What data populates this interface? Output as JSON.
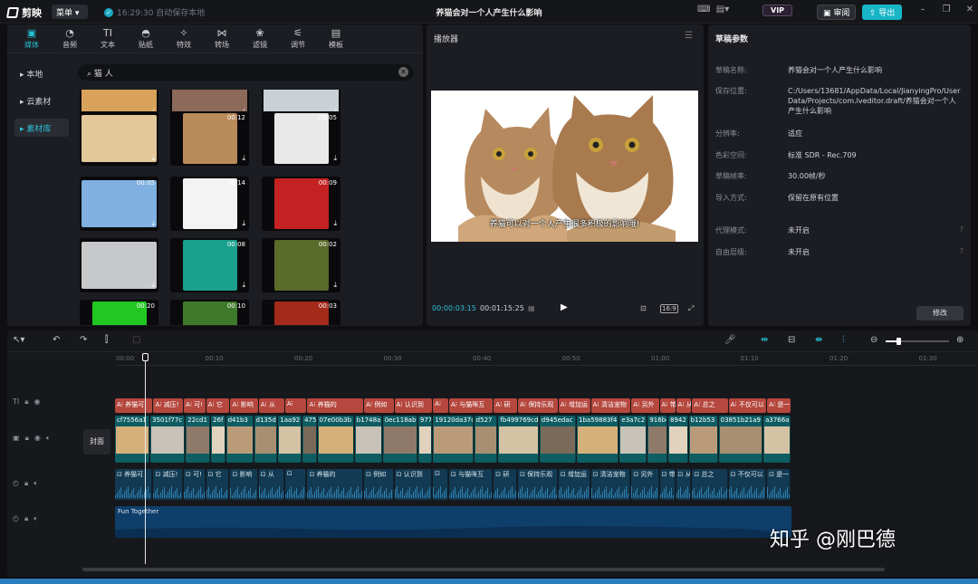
{
  "app": {
    "name": "剪映",
    "menu_label": "菜单",
    "autosave": "16:29:30 自动保存本地",
    "project_title": "养猫会对一个人产生什么影响",
    "vip": "VIP",
    "review": "审阅",
    "export": "导出"
  },
  "tool_tabs": [
    {
      "label": "媒体",
      "icon": "media-icon"
    },
    {
      "label": "音频",
      "icon": "audio-icon"
    },
    {
      "label": "文本",
      "icon": "text-icon"
    },
    {
      "label": "贴纸",
      "icon": "sticker-icon"
    },
    {
      "label": "特效",
      "icon": "effects-icon"
    },
    {
      "label": "转场",
      "icon": "transition-icon"
    },
    {
      "label": "滤镜",
      "icon": "filter-icon"
    },
    {
      "label": "调节",
      "icon": "adjust-icon"
    },
    {
      "label": "模板",
      "icon": "template-icon"
    }
  ],
  "sidebar": [
    {
      "label": "本地"
    },
    {
      "label": "云素材"
    },
    {
      "label": "素材库"
    }
  ],
  "search": {
    "value": "猫 人"
  },
  "thumbs": [
    {
      "dur": "",
      "bg": "#d9a25a"
    },
    {
      "dur": "",
      "bg": "#8c6a5a"
    },
    {
      "dur": "",
      "bg": "#c9d0d6"
    },
    {
      "dur": "",
      "bg": "#e3c89a"
    },
    {
      "dur": "00:12",
      "bg": "#b98a5a"
    },
    {
      "dur": "00:05",
      "bg": "#e9e9e9"
    },
    {
      "dur": "00:05",
      "bg": "#7fb0e0"
    },
    {
      "dur": "00:14",
      "bg": "#f3f3f3"
    },
    {
      "dur": "00:09",
      "bg": "#c42222"
    },
    {
      "dur": "",
      "bg": "#c6c8ca"
    },
    {
      "dur": "00:08",
      "bg": "#1aa08c"
    },
    {
      "dur": "00:02",
      "bg": "#5a6b2a"
    },
    {
      "dur": "00:20",
      "bg": "#22c822"
    },
    {
      "dur": "00:10",
      "bg": "#3f7a2a"
    },
    {
      "dur": "00:03",
      "bg": "#a42a1a"
    }
  ],
  "player": {
    "title": "播放器",
    "subtitle": "养猫可以对一个人产生很多积极的影响哦!",
    "current": "00:00:03:15",
    "total": "00:01:15:25",
    "ratio": "16:9"
  },
  "params": {
    "title": "草稿参数",
    "rows": [
      {
        "k": "草稿名称:",
        "v": "养猫会对一个人产生什么影响"
      },
      {
        "k": "保存位置:",
        "v": "C:/Users/13681/AppData/Local/JianyingPro/User Data/Projects/com.lveditor.draft/养猫会对一个人产生什么影响"
      },
      {
        "k": "分辨率:",
        "v": "适应"
      },
      {
        "k": "色彩空间:",
        "v": "标准 SDR - Rec.709"
      },
      {
        "k": "草稿帧率:",
        "v": "30.00帧/秒"
      },
      {
        "k": "导入方式:",
        "v": "保留在原有位置"
      },
      {
        "k": "代理模式:",
        "v": "未开启"
      },
      {
        "k": "自由层级:",
        "v": "未开启"
      }
    ],
    "modify": "修改"
  },
  "ruler": [
    "00:00",
    "00:10",
    "00:20",
    "00:30",
    "00:40",
    "00:50",
    "01:00",
    "01:10",
    "01:20",
    "01:30"
  ],
  "text_clips": [
    "养猫可",
    "减压!",
    "可!",
    "它",
    "影响",
    "从",
    "",
    "养猫的",
    "例如",
    "认识到",
    "",
    "与猫咪互",
    "研",
    "保持乐观",
    "增加运",
    "清洁宠物",
    "另外",
    "带",
    "从",
    "总之",
    "不仅可以",
    "是一"
  ],
  "video_clips": [
    "cf7556a1",
    "3501f77c",
    "22cd1",
    "26f",
    "d41b3",
    "d135d",
    "1aa92",
    "475",
    "07e00b3b",
    "b1748a",
    "0ec118ab",
    "977",
    "19120da37c",
    "d527",
    "fb499769cd",
    "d945edac",
    "1ba59883f4",
    "e3a7c2",
    "916bc",
    "8942",
    "b12b53",
    "03851b21a9",
    "a3766a"
  ],
  "audio_clips": [
    "养猫可",
    "减压!",
    "可!",
    "它",
    "影响",
    "从",
    "",
    "养猫的",
    "例如",
    "认识到",
    "",
    "与猫咪互",
    "研",
    "保持乐观",
    "增加运",
    "清洁宠物",
    "另外",
    "带",
    "从",
    "总之",
    "不仅可以",
    "是一"
  ],
  "music": {
    "label": "Fun Together"
  },
  "cover": "封面",
  "watermark": "知乎 @刚巴德"
}
